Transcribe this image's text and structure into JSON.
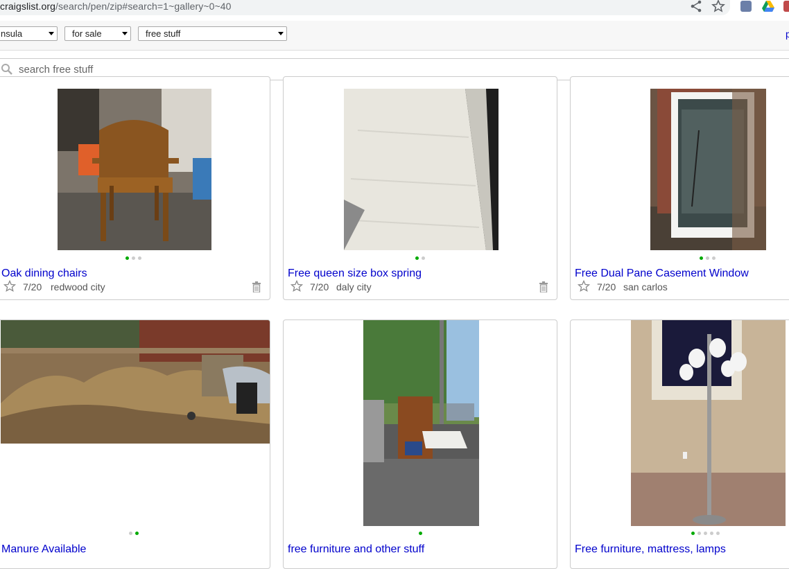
{
  "browser": {
    "url_domain": "craigslist.org",
    "url_path": "/search/pen/zip#search=1~gallery~0~40"
  },
  "filters": {
    "area": "nsula",
    "category": "for sale",
    "subcategory": "free stuff",
    "post_link": "p"
  },
  "search": {
    "placeholder": "search free stuff"
  },
  "listings": [
    {
      "title": "Oak dining chairs",
      "date": "7/20",
      "location": "redwood city",
      "images": 3,
      "active": 0
    },
    {
      "title": "Free queen size box spring",
      "date": "7/20",
      "location": "daly city",
      "images": 2,
      "active": 0
    },
    {
      "title": "Free Dual Pane Casement Window",
      "date": "7/20",
      "location": "san carlos",
      "images": 3,
      "active": 0
    },
    {
      "title": "Manure Available",
      "date": "",
      "location": "",
      "images": 2,
      "active": 1
    },
    {
      "title": "free furniture and other stuff",
      "date": "",
      "location": "",
      "images": 1,
      "active": 0
    },
    {
      "title": "Free furniture, mattress, lamps",
      "date": "",
      "location": "",
      "images": 5,
      "active": 0
    }
  ],
  "colors": {
    "link": "#0000cc",
    "dot_active": "#00aa00",
    "dot_inactive": "#cccccc"
  }
}
